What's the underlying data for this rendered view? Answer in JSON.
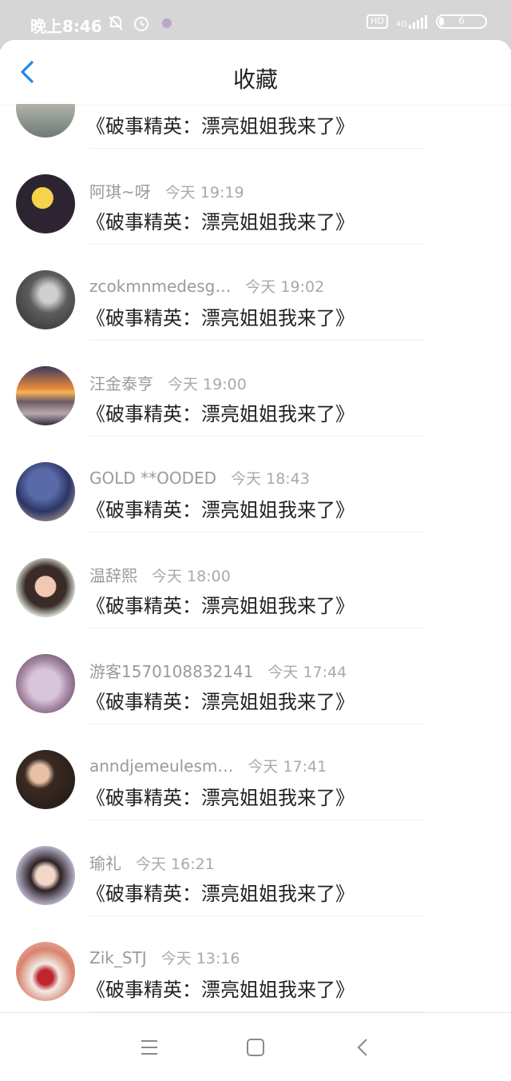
{
  "status_bar": {
    "time": "晚上8:46",
    "network_label": "4G",
    "hd_label": "HD",
    "battery_level": "6"
  },
  "header": {
    "title": "收藏"
  },
  "partial_item": {
    "content": "《破事精英：漂亮姐姐我来了》"
  },
  "items": [
    {
      "user": "阿琪~呀",
      "time": "今天 19:19",
      "content": "《破事精英：漂亮姐姐我来了》"
    },
    {
      "user": "zcokmnmedesg…",
      "time": "今天 19:02",
      "content": "《破事精英：漂亮姐姐我来了》"
    },
    {
      "user": "汪金泰亨",
      "time": "今天 19:00",
      "content": "《破事精英：漂亮姐姐我来了》"
    },
    {
      "user": "GOLD **OODED",
      "time": "今天 18:43",
      "content": "《破事精英：漂亮姐姐我来了》"
    },
    {
      "user": "温辞熙",
      "time": "今天 18:00",
      "content": "《破事精英：漂亮姐姐我来了》"
    },
    {
      "user": "游客1570108832141",
      "time": "今天 17:44",
      "content": "《破事精英：漂亮姐姐我来了》"
    },
    {
      "user": "anndjemeulesm…",
      "time": "今天 17:41",
      "content": "《破事精英：漂亮姐姐我来了》"
    },
    {
      "user": "瑜礼",
      "time": "今天 16:21",
      "content": "《破事精英：漂亮姐姐我来了》"
    },
    {
      "user": "Zik_STJ",
      "time": "今天 13:16",
      "content": "《破事精英：漂亮姐姐我来了》"
    }
  ],
  "colors": {
    "accent": "#1e88e5",
    "status_bar_bg": "#d6d6d6",
    "text_primary": "#222222",
    "text_secondary": "#9a9a9a"
  },
  "icons": {
    "back": "chevron-left-icon",
    "status_left": [
      "mute-icon",
      "alarm-icon",
      "app-notification-icon"
    ],
    "nav": [
      "menu-icon",
      "home-square-icon",
      "back-triangle-icon"
    ]
  }
}
